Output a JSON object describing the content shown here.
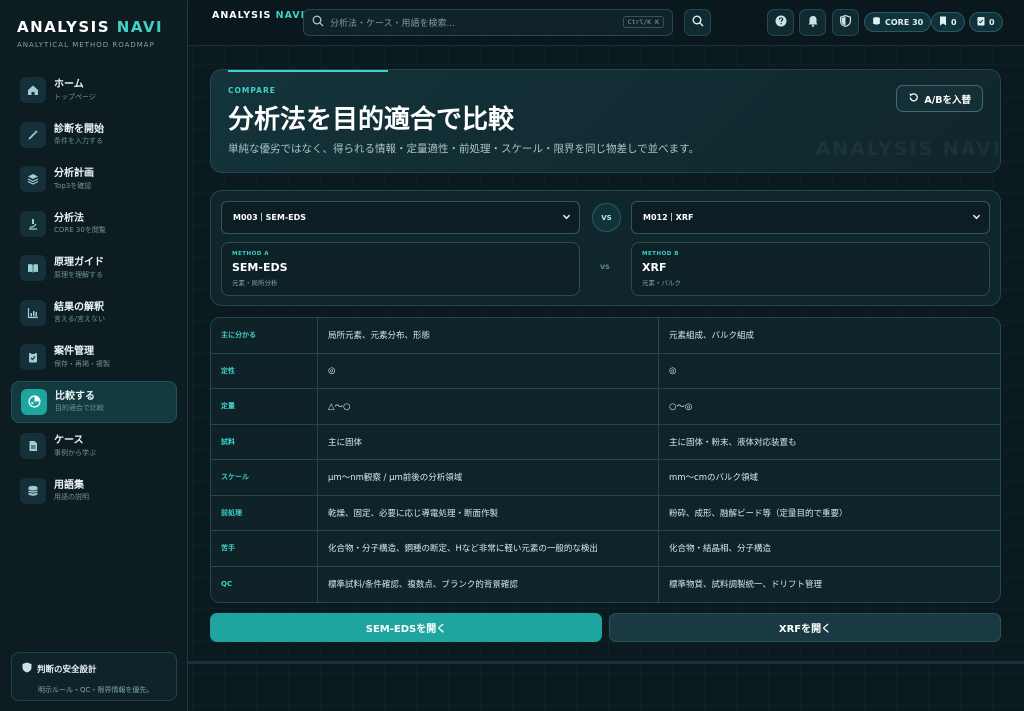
{
  "app": {
    "brand_main": "ANALYSIS ",
    "brand_accent": "NAVI",
    "brand_sub": "ANALYTICAL METHOD ROADMAP",
    "accent_color": "#3fd1c8"
  },
  "sidebar": {
    "items": [
      {
        "label": "ホーム",
        "sub": "トップページ",
        "icon": "home-icon"
      },
      {
        "label": "診断を開始",
        "sub": "条件を入力する",
        "icon": "magic-wand-icon"
      },
      {
        "label": "分析計画",
        "sub": "Top3を確認",
        "icon": "layers-icon"
      },
      {
        "label": "分析法",
        "sub": "CORE 30を閲覧",
        "icon": "microscope-icon"
      },
      {
        "label": "原理ガイド",
        "sub": "原理を理解する",
        "icon": "book-icon"
      },
      {
        "label": "結果の解釈",
        "sub": "言える/言えない",
        "icon": "bar-chart-icon"
      },
      {
        "label": "案件管理",
        "sub": "保存・再掲・複製",
        "icon": "clipboard-icon"
      },
      {
        "label": "比較する",
        "sub": "目的適合で比較",
        "icon": "compare-icon",
        "active": true
      },
      {
        "label": "ケース",
        "sub": "事例から学ぶ",
        "icon": "document-icon"
      },
      {
        "label": "用語集",
        "sub": "用語の説明",
        "icon": "database-icon"
      }
    ],
    "safety": {
      "title": "判断の安全設計",
      "body": "明示ルール・QC・限界情報を優先。"
    }
  },
  "topbar": {
    "brand_main": "ANALYSIS ",
    "brand_accent": "NAVI",
    "search_placeholder": "分析法・ケース・用語を検索...",
    "search_shortcut": "Ctrl/K K",
    "pills": {
      "core": "CORE 30",
      "bookmarks": "0",
      "saved": "0"
    }
  },
  "hero": {
    "eyebrow": "COMPARE",
    "title": "分析法を目的適合で比較",
    "description": "単純な優劣ではなく、得られる情報・定量適性・前処理・スケール・限界を同じ物差しで並べます。",
    "watermark": "ANALYSIS NAVI",
    "swap_label": "A/Bを入替"
  },
  "selector": {
    "method_a_select": "M003｜SEM-EDS",
    "method_b_select": "M012｜XRF",
    "vs": "VS",
    "vs_small": "VS",
    "method_a": {
      "eyebrow": "METHOD A",
      "name": "SEM-EDS",
      "tags": "元素・局所分析"
    },
    "method_b": {
      "eyebrow": "METHOD B",
      "name": "XRF",
      "tags": "元素・バルク"
    }
  },
  "comparison": {
    "rows": [
      {
        "label": "主に分かる",
        "a": "局所元素、元素分布、形態",
        "b": "元素組成、バルク組成"
      },
      {
        "label": "定性",
        "a": "◎",
        "b": "◎"
      },
      {
        "label": "定量",
        "a": "△〜○",
        "b": "○〜◎"
      },
      {
        "label": "試料",
        "a": "主に固体",
        "b": "主に固体・粉末、液体対応装置も"
      },
      {
        "label": "スケール",
        "a": "μm〜nm観察 / μm前後の分析領域",
        "b": "mm〜cmのバルク領域"
      },
      {
        "label": "前処理",
        "a": "乾燥、固定、必要に応じ導電処理・断面作製",
        "b": "粉砕、成形、融解ビード等（定量目的で重要）"
      },
      {
        "label": "苦手",
        "a": "化合物・分子構造、鋼種の断定、Hなど非常に軽い元素の一般的な検出",
        "b": "化合物・結晶相、分子構造"
      },
      {
        "label": "QC",
        "a": "標準試料/条件確認、複数点、ブランク的背景確認",
        "b": "標準物質、試料調製統一、ドリフト管理"
      }
    ]
  },
  "actions": {
    "open_a": "SEM-EDSを開く",
    "open_b": "XRFを開く"
  }
}
